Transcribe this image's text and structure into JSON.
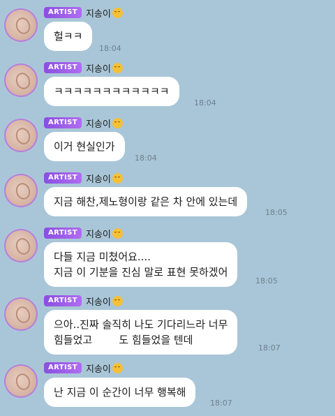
{
  "chat": {
    "badge": "ARTIST",
    "sender": "지송이",
    "emoji": "relieved-face-icon",
    "messages": [
      {
        "text": "헐ㅋㅋ",
        "time": "18:04"
      },
      {
        "text": "ㅋㅋㅋㅋㅋㅋㅋㅋㅋㅋㅋㅋ",
        "time": "18:04"
      },
      {
        "text": "이거 현실인가",
        "time": "18:04"
      },
      {
        "text": "지금 해찬,제노형이랑 같은 차 안에 있는데",
        "time": "18:05"
      },
      {
        "text": "다들 지금 미쳤어요....\n지금 이 기분을 진심 말로 표현 못하겠어",
        "time": "18:05"
      },
      {
        "text": "으아..진짜 솔직히 나도 기다리느라 너무\n힘들었고        도 힘들었을 텐데",
        "time": "18:07"
      },
      {
        "text": "난 지금 이 순간이 너무 행복해",
        "time": "18:07"
      }
    ]
  }
}
